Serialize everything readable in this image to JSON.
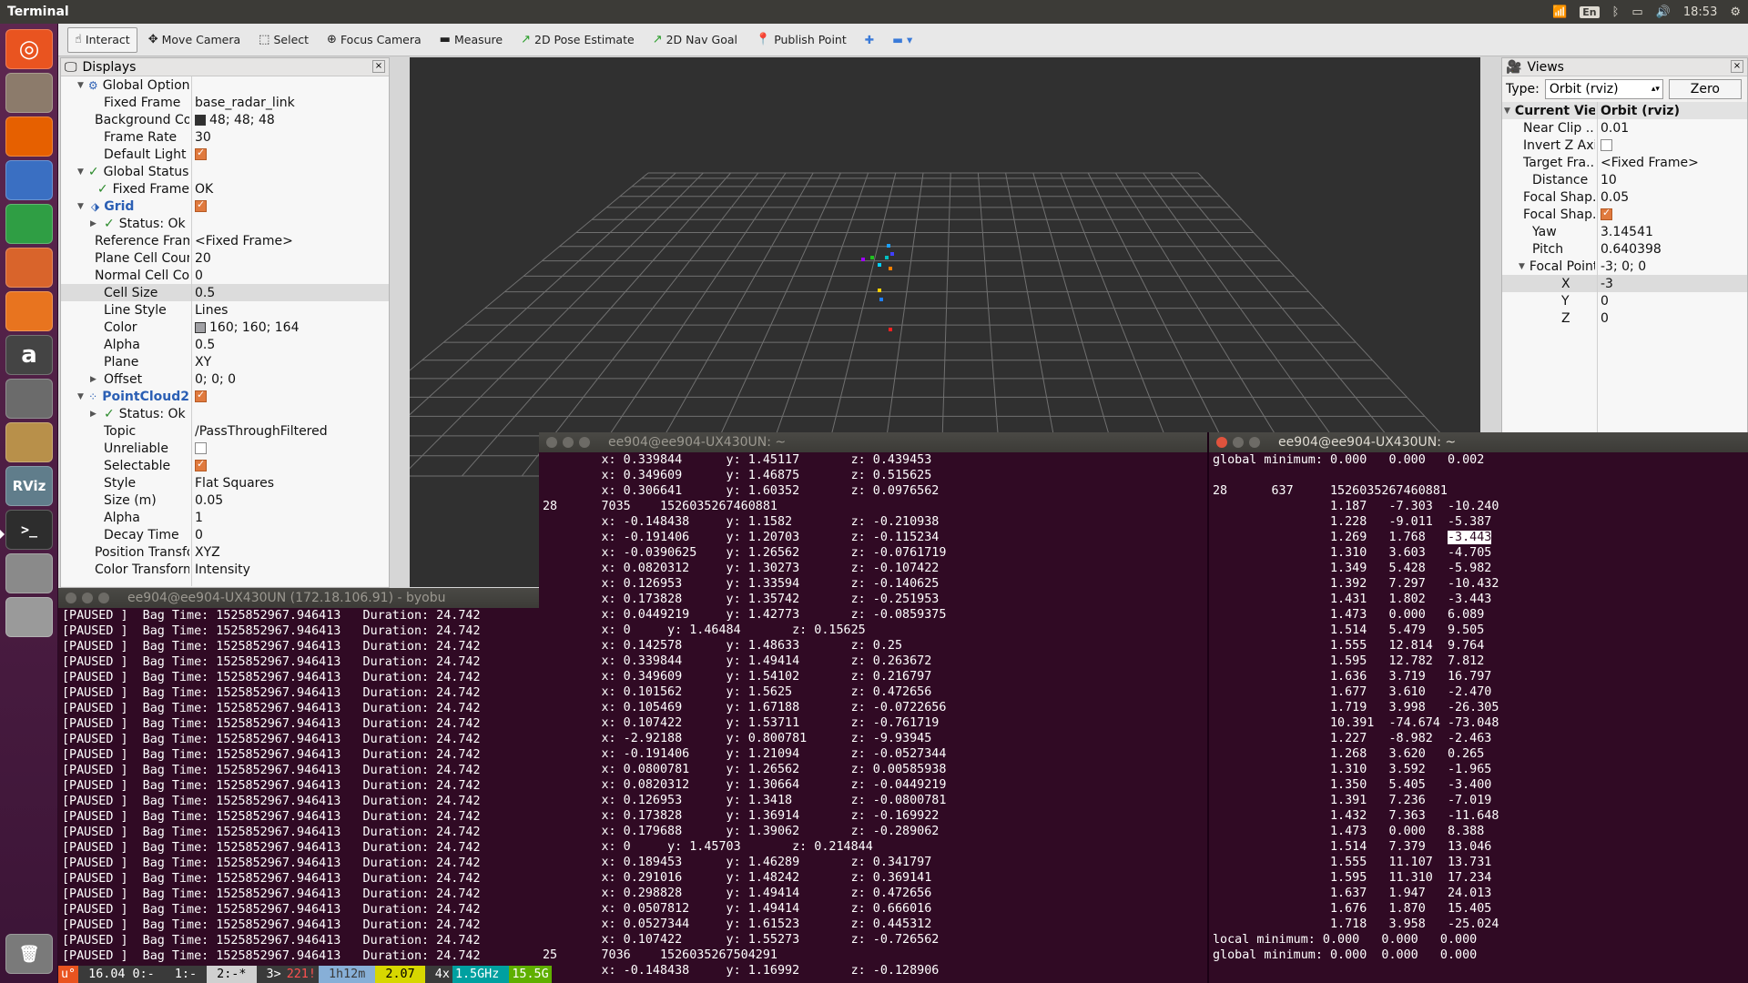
{
  "topbar": {
    "app_title": "Terminal",
    "lang": "En",
    "clock": "18:53",
    "icons": [
      "wifi-icon",
      "bluetooth-icon",
      "battery-icon",
      "volume-icon",
      "settings-gear-icon"
    ]
  },
  "launcher": {
    "items": [
      {
        "name": "ubuntu-dash-icon",
        "bg": "#e95420"
      },
      {
        "name": "files-icon",
        "bg": "#8c7b6b"
      },
      {
        "name": "firefox-icon",
        "bg": "#e66000"
      },
      {
        "name": "writer-icon",
        "bg": "#3a6fc2"
      },
      {
        "name": "calc-icon",
        "bg": "#2f9e44"
      },
      {
        "name": "impress-icon",
        "bg": "#d9642b"
      },
      {
        "name": "software-center-icon",
        "bg": "#e8741f"
      },
      {
        "name": "amazon-icon",
        "bg": "#444444"
      },
      {
        "name": "system-settings-icon",
        "bg": "#6b6b6b"
      },
      {
        "name": "map-app-icon",
        "bg": "#b8904a"
      },
      {
        "name": "rviz-icon",
        "bg": "#607d8b"
      },
      {
        "name": "terminal-icon",
        "bg": "#2d2d2d"
      },
      {
        "name": "text-editor-icon",
        "bg": "#8a8a8a"
      },
      {
        "name": "disk-icon",
        "bg": "#9a9a9a"
      },
      {
        "name": "trash-icon",
        "bg": "#7a7a7a"
      }
    ],
    "amazon_label": "a",
    "rviz_label": "RViz",
    "terminal_label": ">_"
  },
  "toolbar": {
    "tools": [
      {
        "label": "Interact",
        "icon": "☝"
      },
      {
        "label": "Move Camera",
        "icon": "✥"
      },
      {
        "label": "Select",
        "icon": "⬚"
      },
      {
        "label": "Focus Camera",
        "icon": "⊕"
      },
      {
        "label": "Measure",
        "icon": "▬"
      },
      {
        "label": "2D Pose Estimate",
        "icon": "↗"
      },
      {
        "label": "2D Nav Goal",
        "icon": "↗"
      },
      {
        "label": "Publish Point",
        "icon": "📍"
      }
    ],
    "extra_plus": "✚",
    "extra_minus": "▬ ▾"
  },
  "displays": {
    "title": "Displays",
    "close": "×",
    "rows": [
      {
        "k": "Global Options",
        "v": "",
        "tri": "▼",
        "ind": 1,
        "style": "",
        "icon": "⚙"
      },
      {
        "k": "Fixed Frame",
        "v": "base_radar_link",
        "ind": 2
      },
      {
        "k": "Background Color",
        "v": "48; 48; 48",
        "ind": 2,
        "swatch": "#303030"
      },
      {
        "k": "Frame Rate",
        "v": "30",
        "ind": 2
      },
      {
        "k": "Default Light",
        "v": "",
        "ind": 2,
        "cb": true
      },
      {
        "k": "Global Status: Ok",
        "v": "",
        "tri": "▼",
        "ind": 1,
        "check": true
      },
      {
        "k": "Fixed Frame",
        "v": "OK",
        "ind": 2,
        "check": true
      },
      {
        "k": "Grid",
        "v": "",
        "tri": "▼",
        "ind": 1,
        "style": "blue",
        "icon": "⬗",
        "cb": true
      },
      {
        "k": "Status: Ok",
        "v": "",
        "tri": "▶",
        "ind": 2,
        "check": true
      },
      {
        "k": "Reference Frame",
        "v": "<Fixed Frame>",
        "ind": 2
      },
      {
        "k": "Plane Cell Count",
        "v": "20",
        "ind": 2
      },
      {
        "k": "Normal Cell Count",
        "v": "0",
        "ind": 2
      },
      {
        "k": "Cell Size",
        "v": "0.5",
        "ind": 2,
        "sel": true
      },
      {
        "k": "Line Style",
        "v": "Lines",
        "ind": 2
      },
      {
        "k": "Color",
        "v": "160; 160; 164",
        "ind": 2,
        "swatch": "#a0a0a4"
      },
      {
        "k": "Alpha",
        "v": "0.5",
        "ind": 2
      },
      {
        "k": "Plane",
        "v": "XY",
        "ind": 2
      },
      {
        "k": "Offset",
        "v": "0; 0; 0",
        "tri": "▶",
        "ind": 2
      },
      {
        "k": "PointCloud2",
        "v": "",
        "tri": "▼",
        "ind": 1,
        "style": "blue",
        "icon": "⁘",
        "cb": true
      },
      {
        "k": "Status: Ok",
        "v": "",
        "tri": "▶",
        "ind": 2,
        "check": true
      },
      {
        "k": "Topic",
        "v": "/PassThroughFiltered",
        "ind": 2
      },
      {
        "k": "Unreliable",
        "v": "",
        "ind": 2,
        "cbo": true
      },
      {
        "k": "Selectable",
        "v": "",
        "ind": 2,
        "cb": true
      },
      {
        "k": "Style",
        "v": "Flat Squares",
        "ind": 2
      },
      {
        "k": "Size (m)",
        "v": "0.05",
        "ind": 2
      },
      {
        "k": "Alpha",
        "v": "1",
        "ind": 2
      },
      {
        "k": "Decay Time",
        "v": "0",
        "ind": 2
      },
      {
        "k": "Position Transfor...",
        "v": "XYZ",
        "ind": 2
      },
      {
        "k": "Color Transformer",
        "v": "Intensity",
        "ind": 2
      }
    ]
  },
  "views": {
    "title": "Views",
    "type_label": "Type:",
    "type_value": "Orbit (rviz)",
    "zero": "Zero",
    "rows": [
      {
        "k": "Current View",
        "v": "Orbit (rviz)",
        "tri": "▼",
        "bold": true,
        "ind": 0
      },
      {
        "k": "Near Clip ...",
        "v": "0.01",
        "ind": 1
      },
      {
        "k": "Invert Z Axis",
        "v": "",
        "ind": 1,
        "cbo": true
      },
      {
        "k": "Target Fra...",
        "v": "<Fixed Frame>",
        "ind": 1
      },
      {
        "k": "Distance",
        "v": "10",
        "ind": 1
      },
      {
        "k": "Focal Shap...",
        "v": "0.05",
        "ind": 1
      },
      {
        "k": "Focal Shap...",
        "v": "",
        "ind": 1,
        "cb": true
      },
      {
        "k": "Yaw",
        "v": "3.14541",
        "ind": 1
      },
      {
        "k": "Pitch",
        "v": "0.640398",
        "ind": 1
      },
      {
        "k": "Focal Point",
        "v": "-3; 0; 0",
        "tri": "▼",
        "ind": 1
      },
      {
        "k": "X",
        "v": "-3",
        "ind": 3,
        "sel": true
      },
      {
        "k": "Y",
        "v": "0",
        "ind": 3
      },
      {
        "k": "Z",
        "v": "0",
        "ind": 3
      }
    ]
  },
  "viewport_points": [
    {
      "c": "#1ea0ff"
    },
    {
      "c": "#00c0c0"
    },
    {
      "c": "#4040ff"
    },
    {
      "c": "#a000ff"
    },
    {
      "c": "#20c020"
    },
    {
      "c": "#00d0ff"
    },
    {
      "c": "#ff8000"
    },
    {
      "c": "#ffd000"
    },
    {
      "c": "#2080ff"
    },
    {
      "c": "#ff2020"
    }
  ],
  "term_byobu": {
    "title": "ee904@ee904-UX430UN (172.18.106.91) - byobu",
    "lines": [
      "[PAUSED ]  Bag Time: 1525852967.946413   Duration: 24.742",
      "[PAUSED ]  Bag Time: 1525852967.946413   Duration: 24.742",
      "[PAUSED ]  Bag Time: 1525852967.946413   Duration: 24.742",
      "[PAUSED ]  Bag Time: 1525852967.946413   Duration: 24.742",
      "[PAUSED ]  Bag Time: 1525852967.946413   Duration: 24.742",
      "[PAUSED ]  Bag Time: 1525852967.946413   Duration: 24.742",
      "[PAUSED ]  Bag Time: 1525852967.946413   Duration: 24.742",
      "[PAUSED ]  Bag Time: 1525852967.946413   Duration: 24.742",
      "[PAUSED ]  Bag Time: 1525852967.946413   Duration: 24.742",
      "[PAUSED ]  Bag Time: 1525852967.946413   Duration: 24.742",
      "[PAUSED ]  Bag Time: 1525852967.946413   Duration: 24.742",
      "[PAUSED ]  Bag Time: 1525852967.946413   Duration: 24.742",
      "[PAUSED ]  Bag Time: 1525852967.946413   Duration: 24.742",
      "[PAUSED ]  Bag Time: 1525852967.946413   Duration: 24.742",
      "[PAUSED ]  Bag Time: 1525852967.946413   Duration: 24.742",
      "[PAUSED ]  Bag Time: 1525852967.946413   Duration: 24.742",
      "[PAUSED ]  Bag Time: 1525852967.946413   Duration: 24.742",
      "[PAUSED ]  Bag Time: 1525852967.946413   Duration: 24.742",
      "[PAUSED ]  Bag Time: 1525852967.946413   Duration: 24.742",
      "[PAUSED ]  Bag Time: 1525852967.946413   Duration: 24.742",
      "[PAUSED ]  Bag Time: 1525852967.946413   Duration: 24.742",
      "[PAUSED ]  Bag Time: 1525852967.946413   Duration: 24.742",
      "[PAUSED ]  Bag Time: 1525852967.946413   Duration: 24.742"
    ],
    "statusbar": [
      {
        "t": "u°",
        "bg": "#e95420",
        "fg": "#ffffff"
      },
      {
        "t": " 16.04 0:- ",
        "bg": "#3a3a3a",
        "fg": "#ffffff"
      },
      {
        "t": " 1:- ",
        "bg": "#3a3a3a",
        "fg": "#ffffff"
      },
      {
        "t": " 2:-* ",
        "bg": "#d0d0d0",
        "fg": "#000000"
      },
      {
        "t": " 3>",
        "bg": "#3a3a3a",
        "fg": "#ffffff"
      },
      {
        "t": "221!",
        "bg": "#3a3a3a",
        "fg": "#ff5050"
      },
      {
        "t": " 1h12m ",
        "bg": "#87afd7",
        "fg": "#3a3a3a"
      },
      {
        "t": " 2.07 ",
        "bg": "#d7d700",
        "fg": "#000000"
      },
      {
        "t": " 4x",
        "bg": "#3a3a3a",
        "fg": "#ffffff"
      },
      {
        "t": "1.5GHz ",
        "bg": "#00a0a0",
        "fg": "#ffffff"
      },
      {
        "t": "15.5G",
        "bg": "#5faf00",
        "fg": "#ffffff"
      }
    ]
  },
  "term_mid": {
    "title": "ee904@ee904-UX430UN: ~",
    "lines": [
      "        x: 0.339844      y: 1.45117       z: 0.439453",
      "        x: 0.349609      y: 1.46875       z: 0.515625",
      "        x: 0.306641      y: 1.60352       z: 0.0976562",
      "28      7035    1526035267460881",
      "        x: -0.148438     y: 1.1582        z: -0.210938",
      "        x: -0.191406     y: 1.20703       z: -0.115234",
      "        x: -0.0390625    y: 1.26562       z: -0.0761719",
      "        x: 0.0820312     y: 1.30273       z: -0.107422",
      "        x: 0.126953      y: 1.33594       z: -0.140625",
      "        x: 0.173828      y: 1.35742       z: -0.251953",
      "        x: 0.0449219     y: 1.42773       z: -0.0859375",
      "        x: 0     y: 1.46484       z: 0.15625",
      "        x: 0.142578      y: 1.48633       z: 0.25",
      "        x: 0.339844      y: 1.49414       z: 0.263672",
      "        x: 0.349609      y: 1.54102       z: 0.216797",
      "        x: 0.101562      y: 1.5625        z: 0.472656",
      "        x: 0.105469      y: 1.67188       z: -0.0722656",
      "        x: 0.107422      y: 1.53711       z: -0.761719",
      "        x: -2.92188      y: 0.800781      z: -9.93945",
      "        x: -0.191406     y: 1.21094       z: -0.0527344",
      "        x: 0.0800781     y: 1.26562       z: 0.00585938",
      "        x: 0.0820312     y: 1.30664       z: -0.0449219",
      "        x: 0.126953      y: 1.3418        z: -0.0800781",
      "        x: 0.173828      y: 1.36914       z: -0.169922",
      "        x: 0.179688      y: 1.39062       z: -0.289062",
      "        x: 0     y: 1.45703       z: 0.214844",
      "        x: 0.189453      y: 1.46289       z: 0.341797",
      "        x: 0.291016      y: 1.48242       z: 0.369141",
      "        x: 0.298828      y: 1.49414       z: 0.472656",
      "        x: 0.0507812     y: 1.49414       z: 0.666016",
      "        x: 0.0527344     y: 1.61523       z: 0.445312",
      "        x: 0.107422      y: 1.55273       z: -0.726562",
      "25      7036    1526035267504291",
      "        x: -0.148438     y: 1.16992       z: -0.128906"
    ]
  },
  "term_right": {
    "title": "ee904@ee904-UX430UN: ~",
    "lines": [
      "global minimum: 0.000   0.000   0.002",
      "",
      "28      637     1526035267460881",
      "                1.187   -7.303  -10.240",
      "                1.228   -9.011  -5.387",
      "                1.269   1.768   ",
      "                1.310   3.603   -4.705",
      "                1.349   5.428   -5.982",
      "                1.392   7.297   -10.432",
      "                1.431   1.802   -3.443",
      "                1.473   0.000   6.089",
      "                1.514   5.479   9.505",
      "                1.555   12.814  9.764",
      "                1.595   12.782  7.812",
      "                1.636   3.719   16.797",
      "                1.677   3.610   -2.470",
      "                1.719   3.998   -26.305",
      "                10.391  -74.674 -73.048",
      "                1.227   -8.982  -2.463",
      "                1.268   3.620   0.265",
      "                1.310   3.592   -1.965",
      "                1.350   5.405   -3.400",
      "                1.391   7.236   -7.019",
      "                1.432   7.363   -11.648",
      "                1.473   0.000   8.388",
      "                1.514   7.379   13.046",
      "                1.555   11.107  13.731",
      "                1.595   11.310  17.234",
      "                1.637   1.947   24.013",
      "                1.676   1.870   15.405",
      "                1.718   3.958   -25.024",
      "local minimum: 0.000   0.000   0.000",
      "global minimum: 0.000  0.000   0.000"
    ],
    "highlight": "-3.443"
  }
}
